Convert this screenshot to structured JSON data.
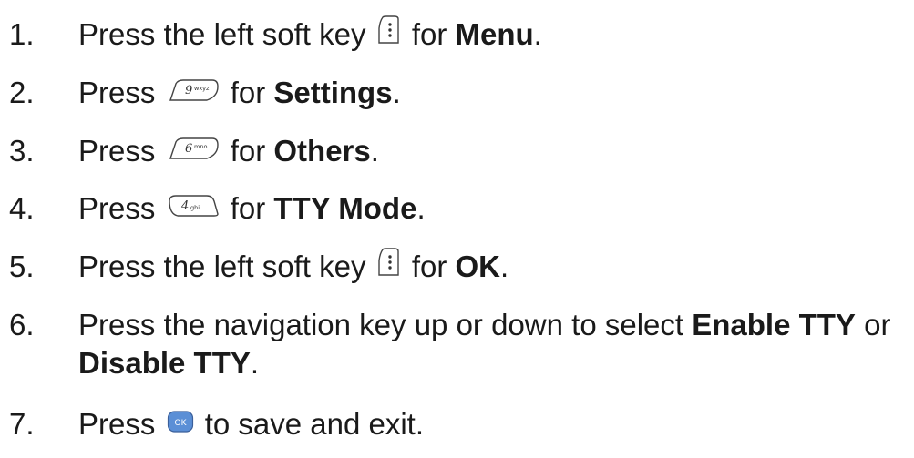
{
  "steps": [
    {
      "num": "1.",
      "pre": "Press the left soft key",
      "mid": "for",
      "bold": "Menu",
      "post": ".",
      "key_icon": "left-soft-key-icon"
    },
    {
      "num": "2.",
      "pre": "Press",
      "mid": "for",
      "bold": "Settings",
      "post": ".",
      "key_icon": "key-9-wxyz-icon",
      "key_label": "9",
      "key_sub": "wxyz"
    },
    {
      "num": "3.",
      "pre": "Press",
      "mid": "for",
      "bold": "Others",
      "post": ".",
      "key_icon": "key-6-mno-icon",
      "key_label": "6",
      "key_sub": "mno"
    },
    {
      "num": "4.",
      "pre": "Press",
      "mid": "for",
      "bold": "TTY Mode",
      "post": ".",
      "key_icon": "key-4-ghi-icon",
      "key_label": "4",
      "key_sub": "ghi"
    },
    {
      "num": "5.",
      "pre": "Press the left soft key",
      "mid": "for",
      "bold": "OK",
      "post": ".",
      "key_icon": "left-soft-key-icon"
    },
    {
      "num": "6.",
      "line1_pre": "Press the navigation key up or down to select",
      "bold1": "Enable TTY",
      "line1_post": "or",
      "bold2": "Disable TTY",
      "post": "."
    },
    {
      "num": "7.",
      "pre": "Press",
      "post": "to save and exit.",
      "key_icon": "ok-key-icon",
      "key_label": "OK"
    }
  ],
  "colors": {
    "text": "#1a1a1a",
    "ok_key": "#5b8fd6",
    "key_outline": "#444444"
  }
}
